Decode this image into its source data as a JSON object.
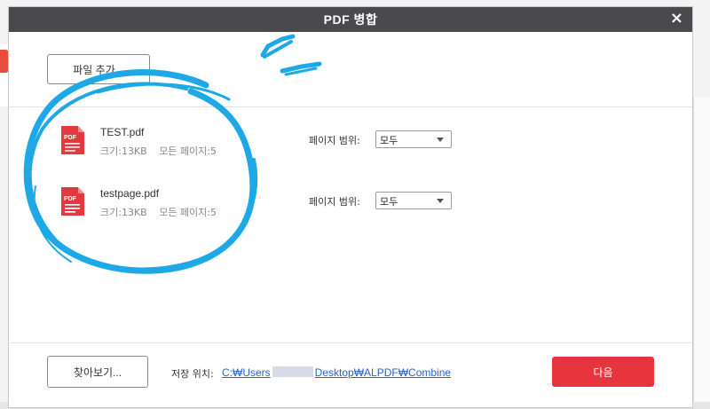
{
  "dialog": {
    "title": "PDF 병합",
    "close_icon": "×",
    "add_button": "파일 추가...",
    "files": [
      {
        "name": "TEST.pdf",
        "size": "크기:13KB",
        "pages": "모든 페이지:5",
        "range_label": "페이지 범위:",
        "range_value": "모두",
        "icon": "pdf-file-icon"
      },
      {
        "name": "testpage.pdf",
        "size": "크기:13KB",
        "pages": "모든 페이지:5",
        "range_label": "페이지 범위:",
        "range_value": "모두",
        "icon": "pdf-file-icon"
      }
    ],
    "browse_button": "찾아보기...",
    "save_location_label": "저장 위치:",
    "save_path_start": "C:₩Users",
    "save_path_end": "Desktop₩ALPDF₩Combine",
    "next_button": "다음"
  },
  "colors": {
    "titlebar": "#4a4a4e",
    "next_button": "#e8343c",
    "pdf_icon": "#e2393f",
    "annotation": "#1fa8e6",
    "link": "#2a62c9"
  }
}
